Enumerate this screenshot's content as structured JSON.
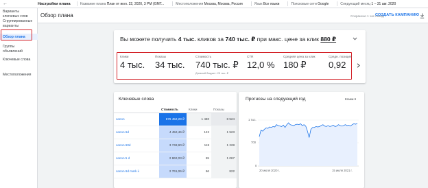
{
  "topbar": {
    "back": "←",
    "plan_title": "Настройки плана",
    "items": [
      {
        "label": "Название плана",
        "value": "План от июл. 22, 2020, 3 PM (GMT..."
      },
      {
        "label": "Местоположения",
        "value": "Москва, Москва, Россия"
      },
      {
        "label": "Язык",
        "value": "Все языки"
      },
      {
        "label": "Поисковые сети",
        "value": "Google"
      },
      {
        "label": "Следующий месяц",
        "value": "1 – 31 авг. 2020"
      }
    ]
  },
  "sidebar": {
    "items": [
      {
        "label": "Варианты ключевых слов"
      },
      {
        "label": "Сгруппированные варианты"
      },
      {
        "label": "Обзор плана"
      },
      {
        "label": "Группы объявлений"
      },
      {
        "label": "Ключевые слова"
      },
      {
        "label": "Местоположения"
      }
    ]
  },
  "header": {
    "title": "Обзор плана",
    "saved": "Сохранено 1 час назад",
    "create": "СОЗДАТЬ КАМПАНИЮ",
    "download_icon": "download-icon"
  },
  "overview": {
    "headline_pre": "Вы можете получить ",
    "headline_clicks": "4 тыс.",
    "headline_mid": " кликов за ",
    "headline_cost": "740 тыс. ₽",
    "headline_mid2": " при макс. цене за клик ",
    "headline_cpc": "880 ₽",
    "metrics": [
      {
        "label": "Клики",
        "value": "4 тыс.",
        "sub": ""
      },
      {
        "label": "Показы",
        "value": "34 тыс.",
        "sub": ""
      },
      {
        "label": "Стоимость",
        "value": "740 тыс. ₽",
        "sub": "Дневной бюджет: 25 тыс. ₽"
      },
      {
        "label": "CTR",
        "value": "12,0 %",
        "sub": ""
      },
      {
        "label": "Средняя цена за клик",
        "value": "180 ₽",
        "sub": ""
      },
      {
        "label": "Средн. позиция",
        "value": "0,92",
        "sub": ""
      }
    ]
  },
  "keywords": {
    "title": "Ключевые слова",
    "columns": [
      "",
      "Стоимость",
      "Клики",
      "Показы"
    ],
    "rows": [
      {
        "name": "canon",
        "cost": "676 452,28 ₽",
        "clicks": "1 480",
        "impr": "8 524"
      },
      {
        "name": "canon 6d",
        "cost": "4 452,46 ₽",
        "clicks": "122",
        "impr": "1 523"
      },
      {
        "name": "canon 60d",
        "cost": "3 748,90 ₽",
        "clicks": "118",
        "impr": "1 228"
      },
      {
        "name": "canon 5 d",
        "cost": "2 862,03 ₽",
        "clicks": "65",
        "impr": "1 067"
      },
      {
        "name": "canon 6d mark ii",
        "cost": "2 761,06 ₽",
        "clicks": "66",
        "impr": "822"
      }
    ]
  },
  "forecast": {
    "title": "Прогнозы на следующий год",
    "metric": "Клики",
    "chart_data": {
      "type": "line",
      "ylabel": "",
      "yticks": [
        "1 тыс.",
        "700",
        "0"
      ],
      "xticks": [
        "20 июля 2020 г.",
        "15 июля 2021 г."
      ],
      "series": [
        {
          "values": [
            640,
            780,
            760,
            800,
            830,
            820,
            850,
            840,
            860,
            850,
            900,
            880,
            870,
            860,
            890,
            840,
            900,
            940,
            900,
            890,
            880,
            900,
            910,
            900,
            920,
            880,
            900,
            870,
            760,
            620,
            800,
            840,
            840,
            860,
            850,
            860,
            880,
            900,
            870,
            860,
            880,
            860,
            870,
            890,
            860,
            870,
            900,
            880,
            870,
            880,
            900,
            880,
            890,
            870,
            900,
            920,
            910,
            930
          ]
        }
      ]
    }
  }
}
